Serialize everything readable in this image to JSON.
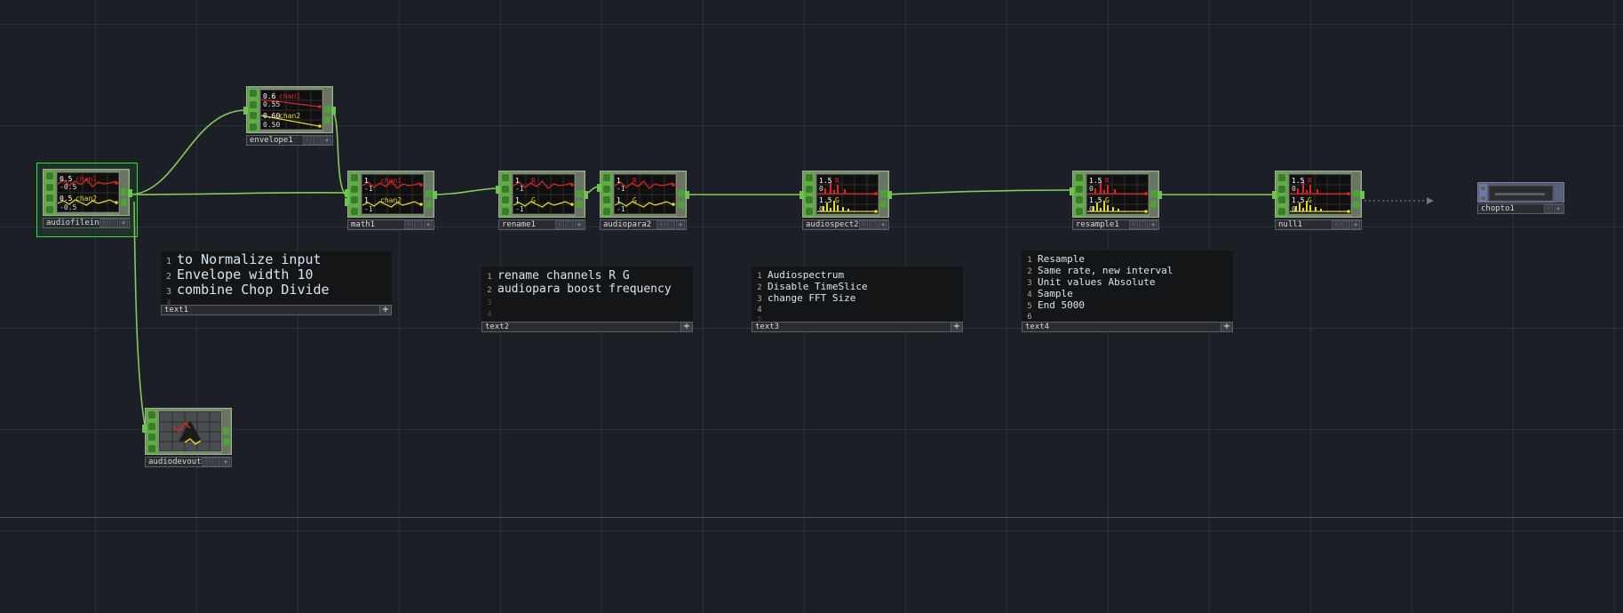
{
  "network": {
    "nodes": [
      {
        "id": "audiofilein1",
        "label": "audiofilein1",
        "preview": "waves",
        "readouts": [
          "chan1",
          "0.5",
          "-0.5",
          "chan2",
          "0.5",
          "-0.5"
        ]
      },
      {
        "id": "envelope1",
        "label": "envelope1",
        "preview": "envelope",
        "readouts": [
          "chan1",
          "0.6",
          "0.55",
          "chan2",
          "0.60",
          "0.50"
        ]
      },
      {
        "id": "math1",
        "label": "math1",
        "preview": "waves",
        "readouts": [
          "chan1",
          "1",
          "-1",
          "chan2",
          "1",
          "-1"
        ]
      },
      {
        "id": "rename1",
        "label": "rename1",
        "preview": "waves",
        "readouts": [
          "R",
          "1",
          "-1",
          "G",
          "1",
          "-1"
        ]
      },
      {
        "id": "audiopara2",
        "label": "audiopara2",
        "preview": "waves",
        "readouts": [
          "R",
          "1",
          "-1",
          "G",
          "1",
          "-1"
        ]
      },
      {
        "id": "audiospect2",
        "label": "audiospect2",
        "preview": "spectrum",
        "readouts": [
          "R",
          "1.5",
          "0",
          "G",
          "1.5",
          "0"
        ]
      },
      {
        "id": "resample1",
        "label": "resample1",
        "preview": "spectrum",
        "readouts": [
          "R",
          "1.5",
          "0",
          "G",
          "1.5",
          "0"
        ]
      },
      {
        "id": "null1",
        "label": "null1",
        "preview": "spectrum",
        "readouts": [
          "R",
          "1.5",
          "0",
          "G",
          "1.5",
          "0"
        ]
      },
      {
        "id": "audiodevout1",
        "label": "audiodevout1",
        "preview": "device",
        "readouts": []
      },
      {
        "id": "chopto1",
        "label": "chopto1",
        "preview": "table",
        "readouts": []
      }
    ],
    "text_dats": [
      {
        "id": "text1",
        "label": "text1",
        "lines": [
          "to Normalize input",
          "Envelope width 10",
          "combine Chop Divide",
          ""
        ]
      },
      {
        "id": "text2",
        "label": "text2",
        "lines": [
          "rename channels R G",
          "audiopara boost frequency",
          "",
          ""
        ]
      },
      {
        "id": "text3",
        "label": "text3",
        "lines": [
          "Audiospectrum",
          "Disable TimeSlice",
          "change FFT Size",
          "",
          ""
        ]
      },
      {
        "id": "text4",
        "label": "text4",
        "lines": [
          "Resample",
          "Same rate, new interval",
          "Unit values Absolute",
          "Sample",
          "End 5000",
          ""
        ]
      }
    ],
    "colors": {
      "background": "#1c1f26",
      "wire": "#8ac85a",
      "chop_node": "#5fae45",
      "dat_node": "#7a6fb0",
      "chan1": "#e02424",
      "chan2": "#e6dc1e",
      "selection": "#3ed63e"
    },
    "icons": {
      "flag_viewer": "eye-icon",
      "flag_bypass": "bypass-icon",
      "flag_plus": "plus-icon"
    }
  }
}
